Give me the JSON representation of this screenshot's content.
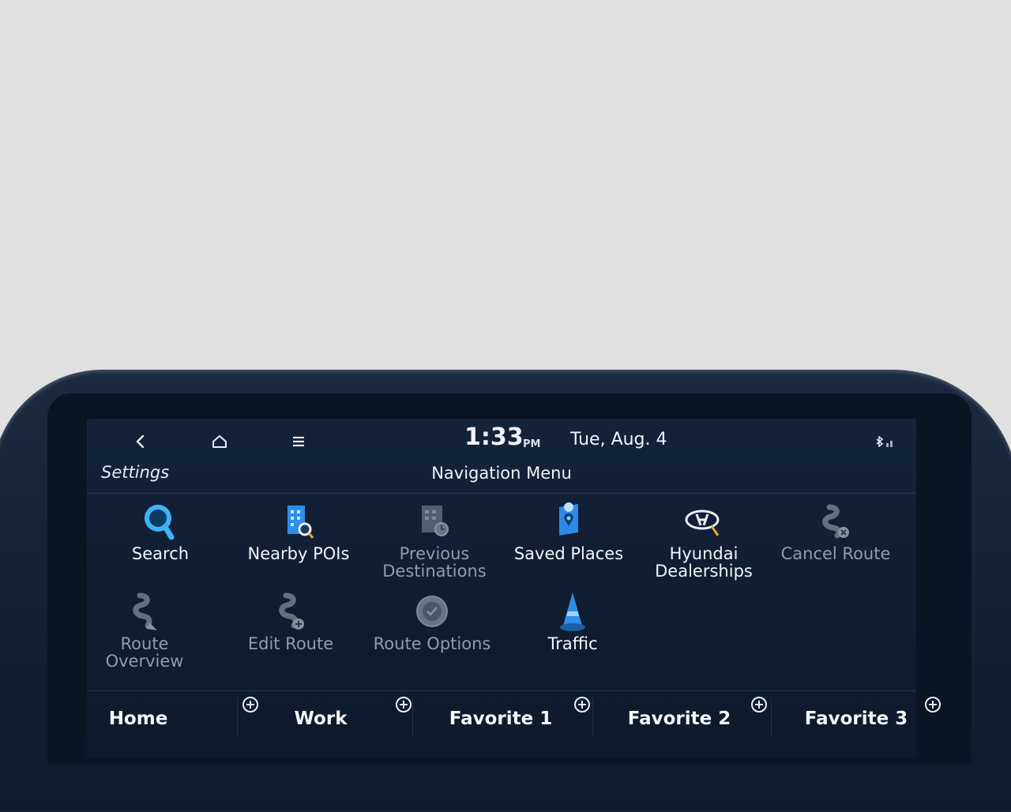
{
  "status": {
    "back_icon": "chevron-left-icon",
    "home_icon": "home-icon",
    "menu_icon": "menu-icon",
    "time": "1:33",
    "ampm": "PM",
    "date": "Tue, Aug. 4",
    "connectivity_icon": "bluetooth-signal-icon"
  },
  "header": {
    "settings_label": "Settings",
    "title": "Navigation Menu"
  },
  "menu": {
    "items": [
      {
        "label": "Search",
        "icon": "search-icon",
        "enabled": true
      },
      {
        "label": "Nearby POIs",
        "icon": "nearby-pois-icon",
        "enabled": true
      },
      {
        "label": "Previous Destinations",
        "icon": "previous-destinations-icon",
        "enabled": false
      },
      {
        "label": "Saved Places",
        "icon": "saved-places-icon",
        "enabled": true
      },
      {
        "label": "Hyundai Dealerships",
        "icon": "hyundai-dealership-icon",
        "enabled": true
      },
      {
        "label": "Cancel Route",
        "icon": "cancel-route-icon",
        "enabled": false
      },
      {
        "label": "Route Overview",
        "icon": "route-overview-icon",
        "enabled": false
      },
      {
        "label": "Edit Route",
        "icon": "edit-route-icon",
        "enabled": false
      },
      {
        "label": "Route Options",
        "icon": "route-options-icon",
        "enabled": false
      },
      {
        "label": "Traffic",
        "icon": "traffic-cone-icon",
        "enabled": true
      }
    ]
  },
  "favorites": {
    "items": [
      {
        "label": "Home"
      },
      {
        "label": "Work"
      },
      {
        "label": "Favorite 1"
      },
      {
        "label": "Favorite 2"
      },
      {
        "label": "Favorite 3"
      }
    ],
    "add_icon": "plus-circle-icon"
  },
  "colors": {
    "screen_bg": "#13233a",
    "accent_blue": "#3a9df5",
    "dim_text": "#8e9cad",
    "text": "#f2f5fa"
  }
}
